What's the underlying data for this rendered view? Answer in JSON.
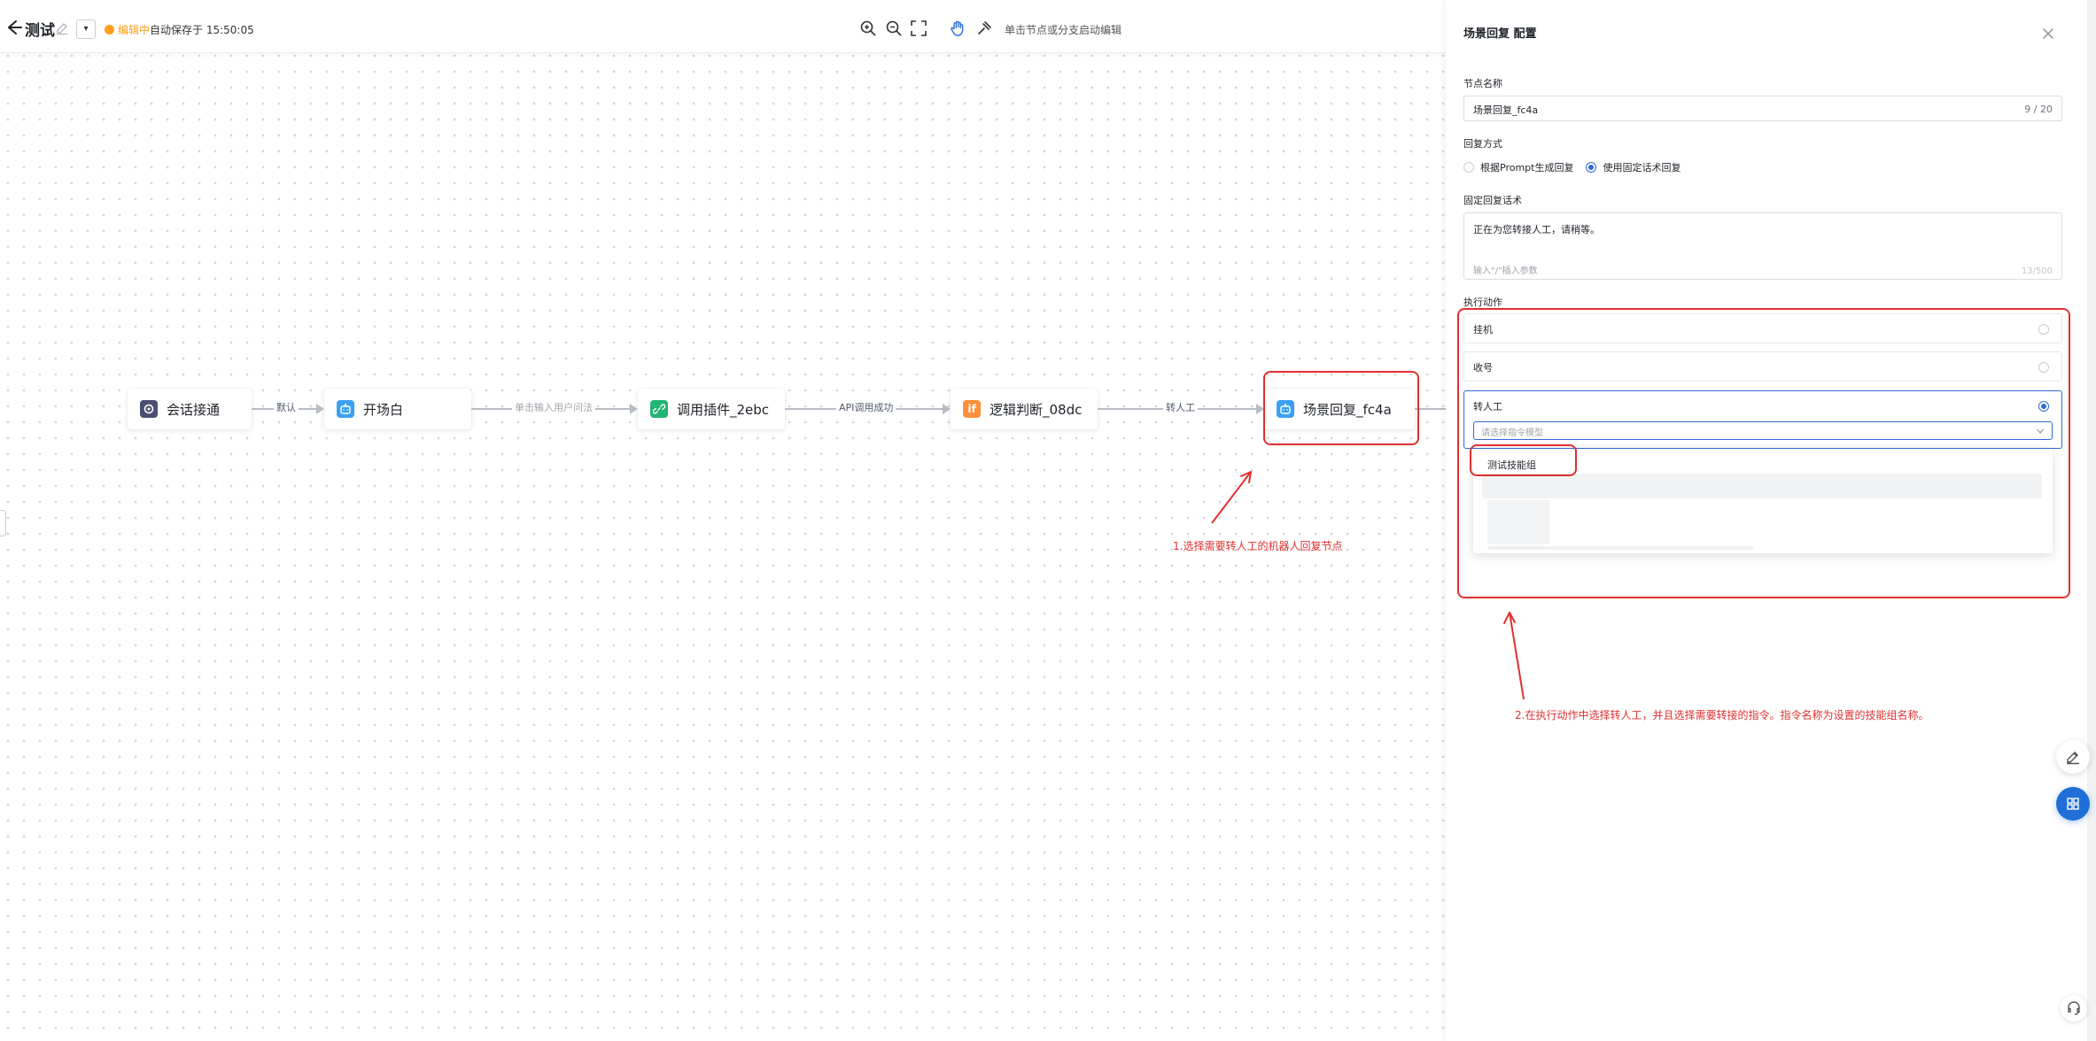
{
  "topbar": {
    "title": "测试",
    "status": "编辑中",
    "autosave": "自动保存于 15:50:05",
    "hint": "单击节点或分支启动编辑",
    "dropdown_glyph": "▾",
    "icons": [
      "back-arrow-icon",
      "edit-icon",
      "zoom-in-icon",
      "zoom-out-icon",
      "fullscreen-icon",
      "hand-icon",
      "auto-layout-icon"
    ]
  },
  "flow": {
    "nodes": [
      {
        "label": "会话接通",
        "icon": "session-icon",
        "color": "#4a4f72"
      },
      {
        "label": "开场白",
        "icon": "robot-icon",
        "color": "#3aa0f5"
      },
      {
        "label": "调用插件_2ebc",
        "icon": "plugin-link-icon",
        "color": "#22b573"
      },
      {
        "label": "逻辑判断_08dc",
        "icon": "if-icon",
        "glyph": "if",
        "color": "#ff8f3a"
      },
      {
        "label": "场景回复_fc4a",
        "icon": "robot-icon",
        "color": "#3aa0f5"
      }
    ],
    "edges": [
      {
        "label": "默认"
      },
      {
        "label": "单击输入用户问法"
      },
      {
        "label": "API调用成功"
      },
      {
        "label": "转人工"
      }
    ],
    "annotation_1": "1.选择需要转人工的机器人回复节点",
    "annotation_2": "2.在执行动作中选择转人工，并且选择需要转接的指令。指令名称为设置的技能组名称。"
  },
  "panel": {
    "title": "场景回复 配置",
    "node_name_label": "节点名称",
    "node_name_value": "场景回复_fc4a",
    "node_name_count": "9 / 20",
    "reply_mode_label": "回复方式",
    "reply_mode_options": [
      {
        "label": "根据Prompt生成回复",
        "checked": false
      },
      {
        "label": "使用固定话术回复",
        "checked": true
      }
    ],
    "fixed_reply_label": "固定回复话术",
    "fixed_reply_value": "正在为您转接人工，请稍等。",
    "fixed_reply_placeholder": "输入\"/\"插入参数",
    "fixed_reply_count": "13/500",
    "action_label": "执行动作",
    "actions": [
      {
        "label": "挂机",
        "checked": false
      },
      {
        "label": "收号",
        "checked": false
      },
      {
        "label": "转人工",
        "checked": true
      }
    ],
    "command_select_placeholder": "请选择指令模型",
    "dropdown_options": [
      "测试技能组"
    ]
  },
  "colors": {
    "accent": "#2f6bd8",
    "annotation": "#e03030",
    "status": "#ff9f1a"
  }
}
